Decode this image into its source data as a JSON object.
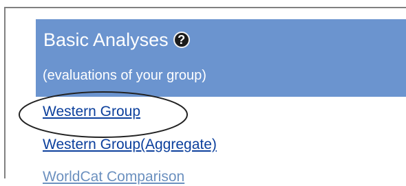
{
  "section": {
    "title": "Basic Analyses",
    "help_icon": "question-mark-circle",
    "subtitle": "(evaluations of your group)"
  },
  "links": [
    {
      "label": "Western Group",
      "highlighted": true
    },
    {
      "label": "Western Group(Aggregate)",
      "highlighted": false
    },
    {
      "label": "WorldCat Comparison",
      "highlighted": false
    }
  ],
  "colors": {
    "panel_background": "#6b94cf",
    "link": "#0b3f9c",
    "frame": "#808080"
  }
}
